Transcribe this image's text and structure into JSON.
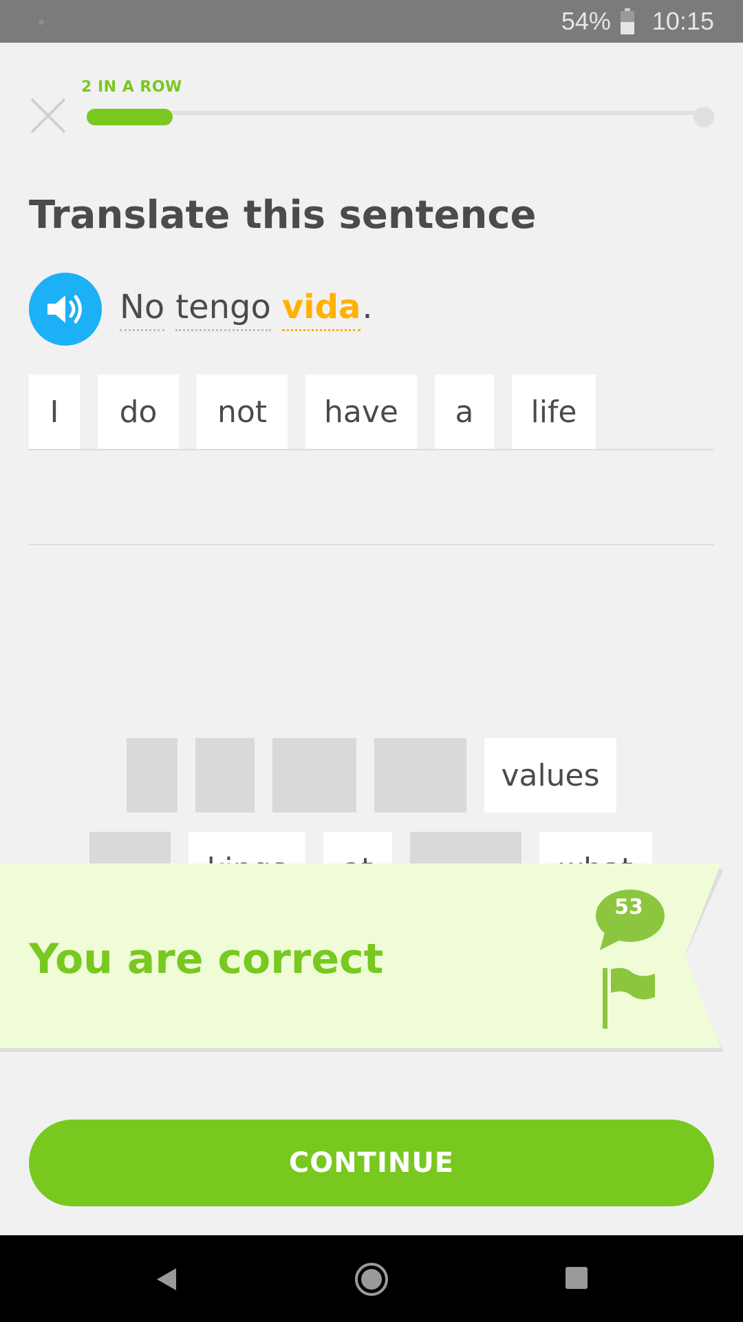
{
  "status_bar": {
    "battery_percent_text": "54%",
    "time": "10:15",
    "battery_level": 0.54
  },
  "header": {
    "streak_label": "2 IN A ROW",
    "progress": 0.14
  },
  "prompt": {
    "title": "Translate this sentence",
    "sentence_words": [
      "No",
      "tengo",
      "vida"
    ],
    "sentence_punct": "."
  },
  "answer_tiles": [
    "I",
    "do",
    "not",
    "have",
    "a",
    "life"
  ],
  "word_bank": {
    "row1_visible": "values",
    "row2_visible": [
      "kings",
      "at",
      "what"
    ]
  },
  "feedback": {
    "message": "You are correct",
    "comment_count": "53"
  },
  "footer": {
    "continue_label": "CONTINUE"
  },
  "colors": {
    "green": "#78c820",
    "blue": "#1cb0f6",
    "highlight": "#ffb100",
    "banner_bg": "#f0fcd8"
  },
  "icons": [
    "close-icon",
    "speaker-icon",
    "comment-icon",
    "flag-icon",
    "battery-icon",
    "nav-back-icon",
    "nav-home-icon",
    "nav-recent-icon"
  ]
}
